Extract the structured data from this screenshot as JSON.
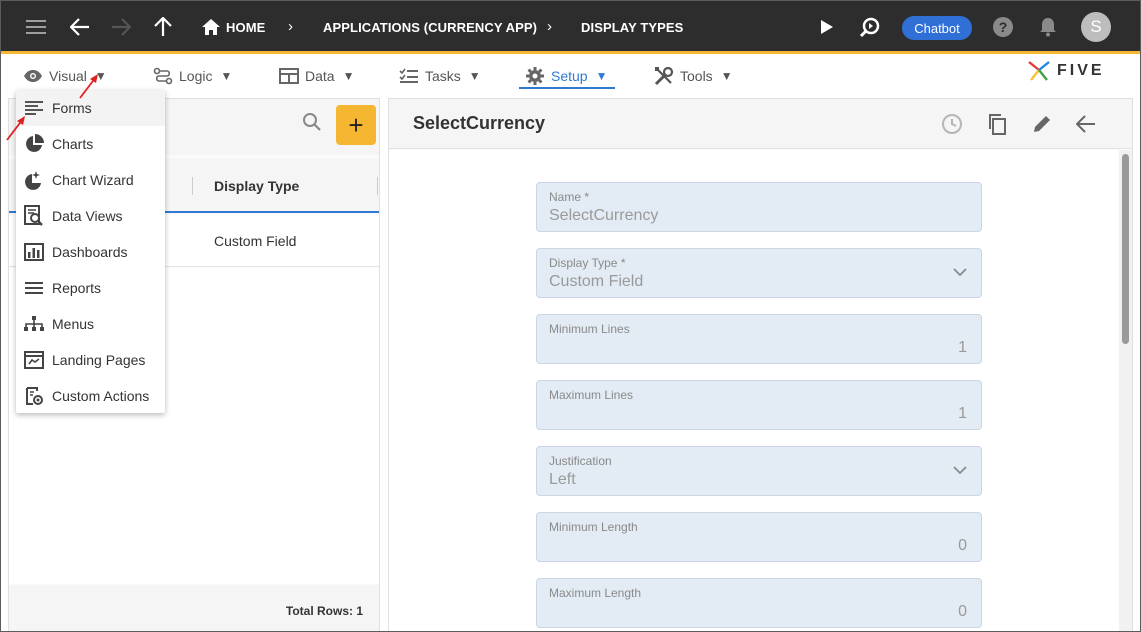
{
  "topbar": {
    "home_label": "HOME",
    "crumb_app": "APPLICATIONS (CURRENCY APP)",
    "crumb_display": "DISPLAY TYPES",
    "chatbot_label": "Chatbot",
    "avatar_letter": "S"
  },
  "menubar": {
    "items": [
      {
        "label": "Visual"
      },
      {
        "label": "Logic"
      },
      {
        "label": "Data"
      },
      {
        "label": "Tasks"
      },
      {
        "label": "Setup"
      },
      {
        "label": "Tools"
      }
    ],
    "caret": "▼",
    "logo_text": "FIVE"
  },
  "dropdown": {
    "items": [
      {
        "label": "Forms"
      },
      {
        "label": "Charts"
      },
      {
        "label": "Chart Wizard"
      },
      {
        "label": "Data Views"
      },
      {
        "label": "Dashboards"
      },
      {
        "label": "Reports"
      },
      {
        "label": "Menus"
      },
      {
        "label": "Landing Pages"
      },
      {
        "label": "Custom Actions"
      }
    ]
  },
  "list": {
    "add_label": "+",
    "column_header": "Display Type",
    "rows": [
      {
        "display_type": "Custom Field"
      }
    ],
    "total_rows": "Total Rows: 1"
  },
  "form": {
    "title": "SelectCurrency",
    "fields": [
      {
        "label": "Name *",
        "value": "SelectCurrency"
      },
      {
        "label": "Display Type *",
        "value": "Custom Field"
      },
      {
        "label": "Minimum Lines",
        "value": "1"
      },
      {
        "label": "Maximum Lines",
        "value": "1"
      },
      {
        "label": "Justification",
        "value": "Left"
      },
      {
        "label": "Minimum Length",
        "value": "0"
      },
      {
        "label": "Maximum Length",
        "value": "0"
      }
    ]
  },
  "colors": {
    "topbar_bg": "#2d2d2d",
    "accent": "#f5b731",
    "active_blue": "#2f7bd3",
    "chatbot_blue": "#2f6fd6",
    "field_bg": "#e3ebf4",
    "annotation_red": "#e0201f"
  }
}
